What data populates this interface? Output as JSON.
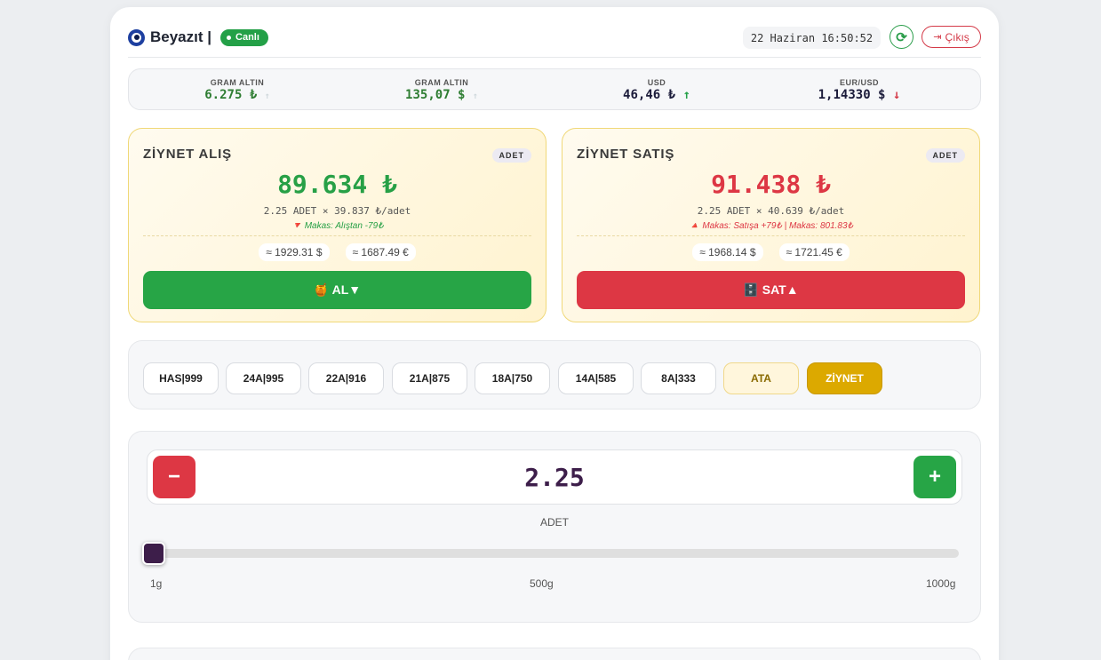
{
  "header": {
    "brand": "Beyazıt |",
    "live_label": "Canlı",
    "clock": "22 Haziran 16:50:52",
    "logout_label": "Çıkış"
  },
  "ticker": [
    {
      "label": "GRAM ALTIN",
      "value": "6.275 ₺",
      "trend": "faint-up"
    },
    {
      "label": "GRAM ALTIN",
      "value": "135,07 $",
      "trend": "faint-up"
    },
    {
      "label": "USD",
      "value": "46,46 ₺",
      "trend": "up"
    },
    {
      "label": "EUR/USD",
      "value": "1,14330 $",
      "trend": "down"
    }
  ],
  "buy": {
    "title": "ZİYNET ALIŞ",
    "badge": "ADET",
    "price": "89.634 ₺",
    "calc": "2.25 ADET × 39.837 ₺/adet",
    "spread": "🔻 Makas: Alıştan -79₺",
    "usd": "≈ 1929.31 $",
    "eur": "≈ 1687.49 €",
    "button": "🍯 AL▼"
  },
  "sell": {
    "title": "ZİYNET SATIŞ",
    "badge": "ADET",
    "price": "91.438 ₺",
    "calc": "2.25 ADET × 40.639 ₺/adet",
    "spread": "🔺 Makas: Satışa +79₺ | Makas: 801.83₺",
    "usd": "≈ 1968.14 $",
    "eur": "≈ 1721.45 €",
    "button": "🗄️ SAT▲"
  },
  "purity": {
    "options": [
      "HAS|999",
      "24A|995",
      "22A|916",
      "21A|875",
      "18A|750",
      "14A|585",
      "8A|333",
      "ATA",
      "ZİYNET"
    ],
    "selected": "ZİYNET"
  },
  "quantity": {
    "value": "2.25",
    "unit": "ADET",
    "slider_fraction": 0.00125,
    "min_label": "1g",
    "mid_label": "500g",
    "max_label": "1000g"
  },
  "colors": {
    "buy": "#27a546",
    "sell": "#dd3744",
    "accent": "#3d1e4a",
    "active_chip": "#dca900"
  }
}
